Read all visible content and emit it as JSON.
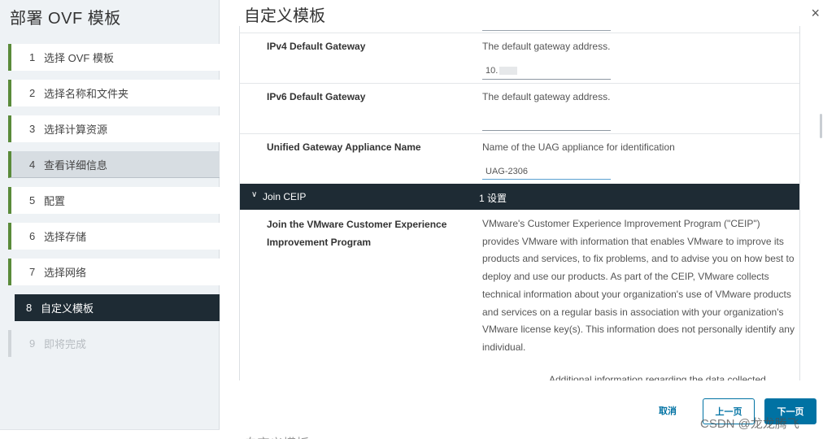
{
  "sidebar": {
    "title": "部署 OVF 模板",
    "steps": [
      {
        "num": "1",
        "label": "选择 OVF 模板"
      },
      {
        "num": "2",
        "label": "选择名称和文件夹"
      },
      {
        "num": "3",
        "label": "选择计算资源"
      },
      {
        "num": "4",
        "label": "查看详细信息"
      },
      {
        "num": "5",
        "label": "配置"
      },
      {
        "num": "6",
        "label": "选择存储"
      },
      {
        "num": "7",
        "label": "选择网络"
      },
      {
        "num": "8",
        "label": "自定义模板"
      },
      {
        "num": "9",
        "label": "即将完成"
      }
    ]
  },
  "main": {
    "title": "自定义模板",
    "close_icon": "×",
    "rows": [
      {
        "label": "IPv4 Default Gateway",
        "desc": "The default gateway address.",
        "value": "10."
      },
      {
        "label": "IPv6 Default Gateway",
        "desc": "The default gateway address.",
        "value": ""
      },
      {
        "label": "Unified Gateway Appliance Name",
        "desc": "Name of the UAG appliance for identification",
        "value": "UAG-2306"
      }
    ],
    "section": {
      "name": "Join CEIP",
      "count": "1 设置"
    },
    "ceip": {
      "label": "Join the VMware Customer Experience Improvement Program",
      "text": "VMware's Customer Experience Improvement Program (\"CEIP\") provides VMware with information that enables VMware to improve its products and services, to fix problems, and to advise you on how best to deploy and use our products.  As part of the CEIP, VMware collects technical information about your organization's use of VMware products and services on a regular basis in association with your organization's VMware license key(s).  This information does not personally identify any individual.",
      "more": "Additional information regarding the data collected"
    }
  },
  "footer": {
    "cancel": "取消",
    "prev": "上一页",
    "next": "下一页"
  },
  "watermark": "CSDN @龙龙腾飞",
  "bottom_title": "自定义模板",
  "colors": {
    "accent": "#0072a3",
    "dark": "#1e2b34",
    "step_bar": "#5a8b3a"
  }
}
